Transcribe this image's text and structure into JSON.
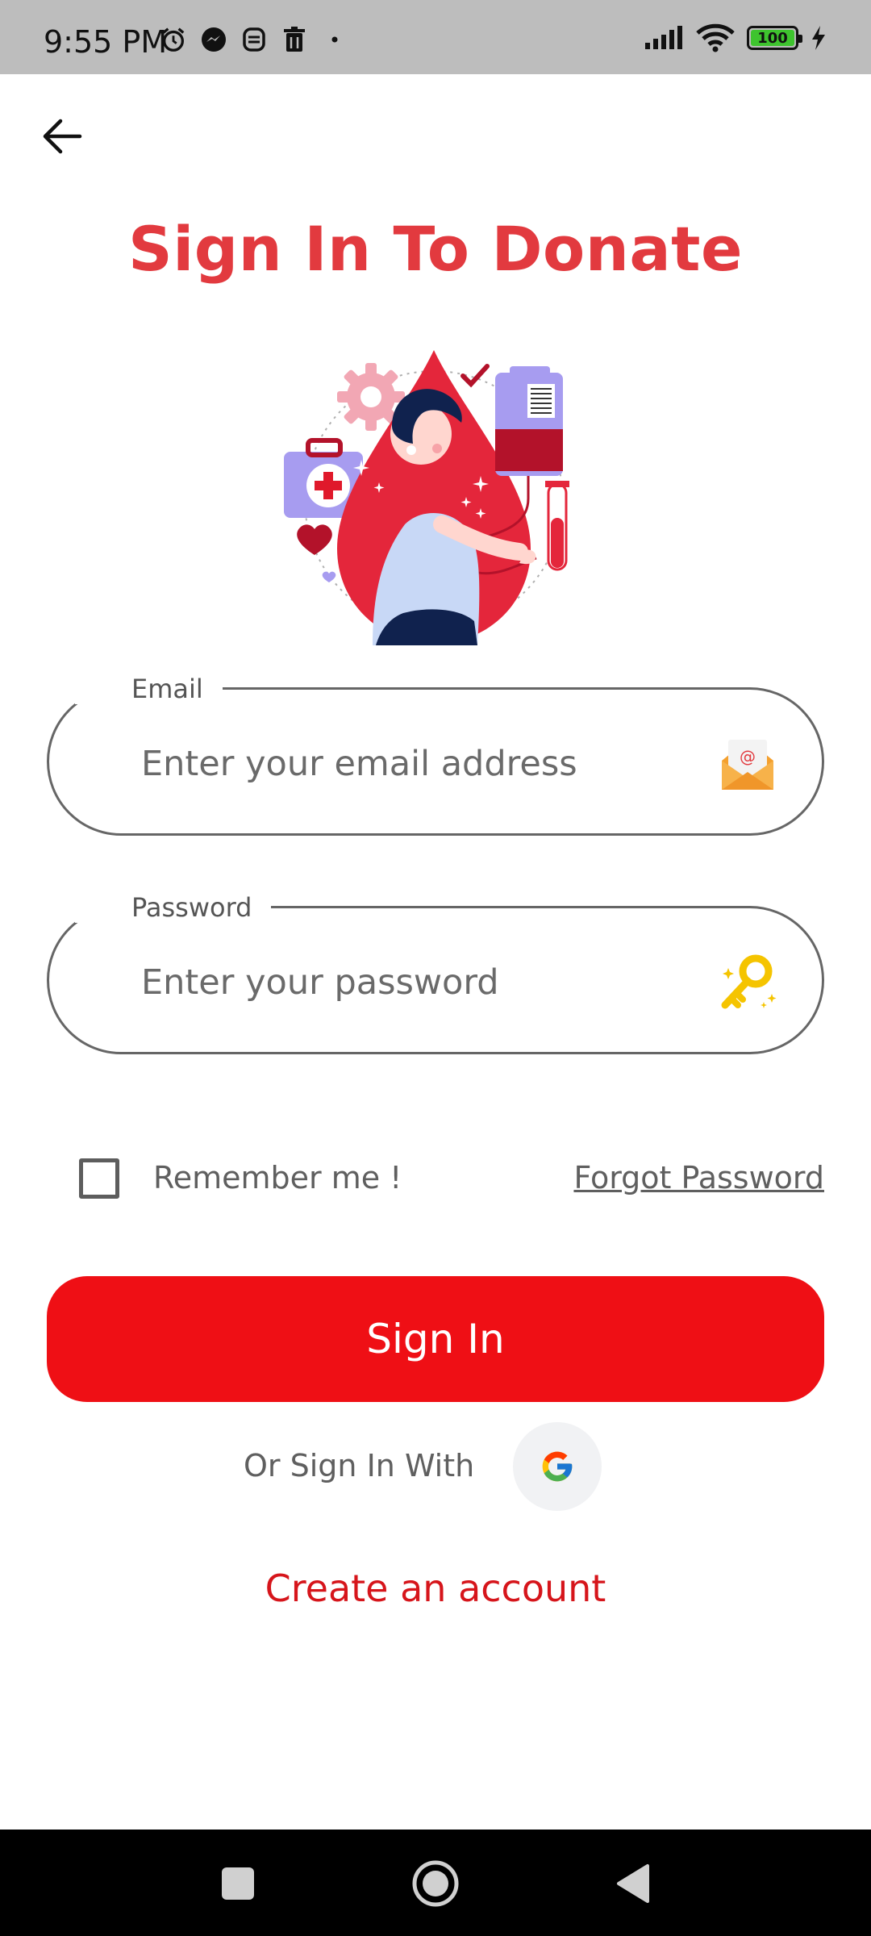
{
  "status_bar": {
    "time": "9:55 PM",
    "battery": "100",
    "icons_left": [
      "alarm-icon",
      "messenger-icon",
      "app-notification-icon",
      "trash-icon",
      "dot-icon"
    ],
    "icons_right": [
      "signal-icon",
      "wifi-icon",
      "battery-icon",
      "charging-icon"
    ]
  },
  "header": {
    "back_icon": "arrow-left-icon",
    "title": "Sign In To Donate"
  },
  "illustration": "blood-donation-illustration",
  "email_field": {
    "label": "Email",
    "placeholder": "Enter your email address",
    "value": "",
    "icon": "envelope-icon"
  },
  "password_field": {
    "label": "Password",
    "placeholder": "Enter your password",
    "value": "",
    "icon": "key-icon"
  },
  "remember": {
    "label": "Remember me !",
    "checked": false
  },
  "forgot_password": "Forgot Password",
  "sign_in_button": "Sign In",
  "social": {
    "label": "Or Sign In With",
    "icon": "google-icon"
  },
  "create_account": "Create an account",
  "colors": {
    "title": "#e23a3f",
    "primary_button": "#ef0f15",
    "link_red": "#d6151b",
    "status_bar": "#bdbdbd",
    "nav_bar": "#000000"
  },
  "nav_bar": [
    "recents-square-icon",
    "home-circle-icon",
    "back-triangle-icon"
  ]
}
